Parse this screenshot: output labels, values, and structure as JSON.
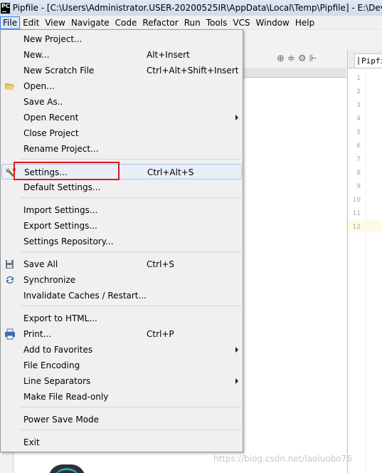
{
  "window": {
    "app_logo": "PC",
    "title": "Pipfile - [C:\\Users\\Administrator.USER-20200525IR\\AppData\\Local\\Temp\\Pipfile] - E:\\DevP"
  },
  "menubar": {
    "items": [
      "File",
      "Edit",
      "View",
      "Navigate",
      "Code",
      "Refactor",
      "Run",
      "Tools",
      "VCS",
      "Window",
      "Help"
    ],
    "active": "File"
  },
  "file_menu": {
    "items": [
      {
        "label": "New Project...",
        "shortcut": ""
      },
      {
        "label": "New...",
        "shortcut": "Alt+Insert"
      },
      {
        "label": "New Scratch File",
        "shortcut": "Ctrl+Alt+Shift+Insert"
      },
      {
        "label": "Open...",
        "shortcut": "",
        "icon": "folder-open-icon"
      },
      {
        "label": "Save As..",
        "shortcut": ""
      },
      {
        "label": "Open Recent",
        "shortcut": "",
        "submenu": true
      },
      {
        "label": "Close Project",
        "shortcut": ""
      },
      {
        "label": "Rename Project...",
        "shortcut": ""
      },
      {
        "label": "Settings...",
        "shortcut": "Ctrl+Alt+S",
        "icon": "wrench-icon",
        "highlighted": true
      },
      {
        "label": "Default Settings...",
        "shortcut": ""
      },
      {
        "label": "Import Settings...",
        "shortcut": ""
      },
      {
        "label": "Export Settings...",
        "shortcut": ""
      },
      {
        "label": "Settings Repository...",
        "shortcut": ""
      },
      {
        "label": "Save All",
        "shortcut": "Ctrl+S",
        "icon": "save-all-icon"
      },
      {
        "label": "Synchronize",
        "shortcut": "",
        "icon": "sync-icon"
      },
      {
        "label": "Invalidate Caches / Restart...",
        "shortcut": ""
      },
      {
        "label": "Export to HTML...",
        "shortcut": ""
      },
      {
        "label": "Print...",
        "shortcut": "Ctrl+P",
        "icon": "printer-icon"
      },
      {
        "label": "Add to Favorites",
        "shortcut": "",
        "submenu": true
      },
      {
        "label": "File Encoding",
        "shortcut": ""
      },
      {
        "label": "Line Separators",
        "shortcut": "",
        "submenu": true
      },
      {
        "label": "Make File Read-only",
        "shortcut": ""
      },
      {
        "label": "Power Save Mode",
        "shortcut": ""
      },
      {
        "label": "Exit",
        "shortcut": ""
      }
    ]
  },
  "editor": {
    "tab_label": "Pipfile",
    "line_numbers": [
      "1",
      "2",
      "3",
      "4",
      "5",
      "6",
      "7",
      "8",
      "9",
      "10",
      "11",
      "12"
    ],
    "current_line": "12"
  },
  "toolbar": {
    "icons": [
      "target-icon",
      "collapse-icon",
      "gear-icon",
      "pin-icon"
    ]
  },
  "watermark": "https://blog.csdn.net/laoluobo76",
  "colors": {
    "highlight_border": "#e2161a",
    "menu_hover": "#e8eff8",
    "current_line": "#fdfbe4"
  }
}
